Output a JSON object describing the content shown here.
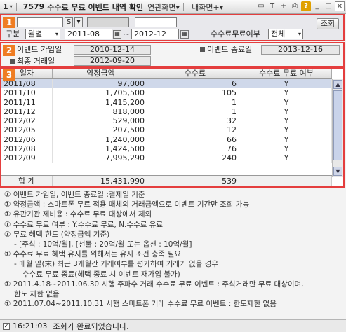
{
  "titlebar": {
    "menu_num": "1",
    "screen_id": "7579",
    "title": "수수료 무료 이벤트 내역 확인",
    "related": "연관화면",
    "my_screen": "내화면",
    "plus": "+"
  },
  "section1": {
    "badge": "1",
    "account_type": "S",
    "category_label": "구분",
    "category_value": "월별",
    "date_from": "2011-08",
    "tilde": "~",
    "date_to": "2012-12",
    "free_label": "수수료무료여부",
    "free_value": "전체",
    "query_button": "조회"
  },
  "section2": {
    "badge": "2",
    "join_label": "이벤트 가입일",
    "join_value": "2010-12-14",
    "end_label": "이벤트 종료일",
    "end_value": "2013-12-16",
    "last_trade_label": "최종 거래일",
    "last_trade_value": "2012-09-20"
  },
  "grid": {
    "badge": "3",
    "headers": [
      "일자",
      "약정금액",
      "수수료",
      "수수료 무료 여부"
    ],
    "rows": [
      [
        "2011/08",
        "97,000",
        "6",
        "Y"
      ],
      [
        "2011/10",
        "1,705,500",
        "105",
        "Y"
      ],
      [
        "2011/11",
        "1,415,200",
        "1",
        "Y"
      ],
      [
        "2011/12",
        "818,000",
        "1",
        "Y"
      ],
      [
        "2012/02",
        "529,000",
        "32",
        "Y"
      ],
      [
        "2012/05",
        "207,500",
        "12",
        "Y"
      ],
      [
        "2012/06",
        "1,240,000",
        "66",
        "Y"
      ],
      [
        "2012/08",
        "1,424,500",
        "76",
        "Y"
      ],
      [
        "2012/09",
        "7,995,290",
        "240",
        "Y"
      ]
    ],
    "total_label": "합  계",
    "total_amount": "15,431,990",
    "total_fee": "539"
  },
  "notes": [
    "① 이벤트 가입일, 이벤트 종료일 :결제일 기준",
    "① 약정금액 : 스마트폰 무료 적용 매체의 거래금액으로 이벤트 기간만 조회 가능",
    "① 유관기관 제비용 : 수수료 무료 대상에서 제외",
    "① 수수료 무료 여부 : Y.수수료 무료, N.수수료 유료",
    "① 무료 혜택 한도 (약정금액 기준)",
    "- [주식 : 10억/월], [선물 : 20억/월 또는 옵션 : 10억/월]",
    "① 수수료 무료 혜택 유지를 위해서는 유지 조건 충족 필요",
    "- 매월 말(末) 최근 3개월간 거래여부를 평가하여 거래가 없을 경우",
    "수수료 무료 종료(혜택 종료 시 이벤트 재가입 불가)",
    "① 2011.4.18~2011.06.30 시행 주파수 거래 수수료 무료 이벤트 : 주식거래만 무료 대상이며,",
    "한도 제한 없음",
    "① 2011.07.04~2011.10.31 시행 스마트폰 거래 수수료 무료 이벤트 : 한도제한 없음"
  ],
  "statusbar": {
    "time": "16:21:03",
    "message": "조회가 완료되었습니다."
  }
}
